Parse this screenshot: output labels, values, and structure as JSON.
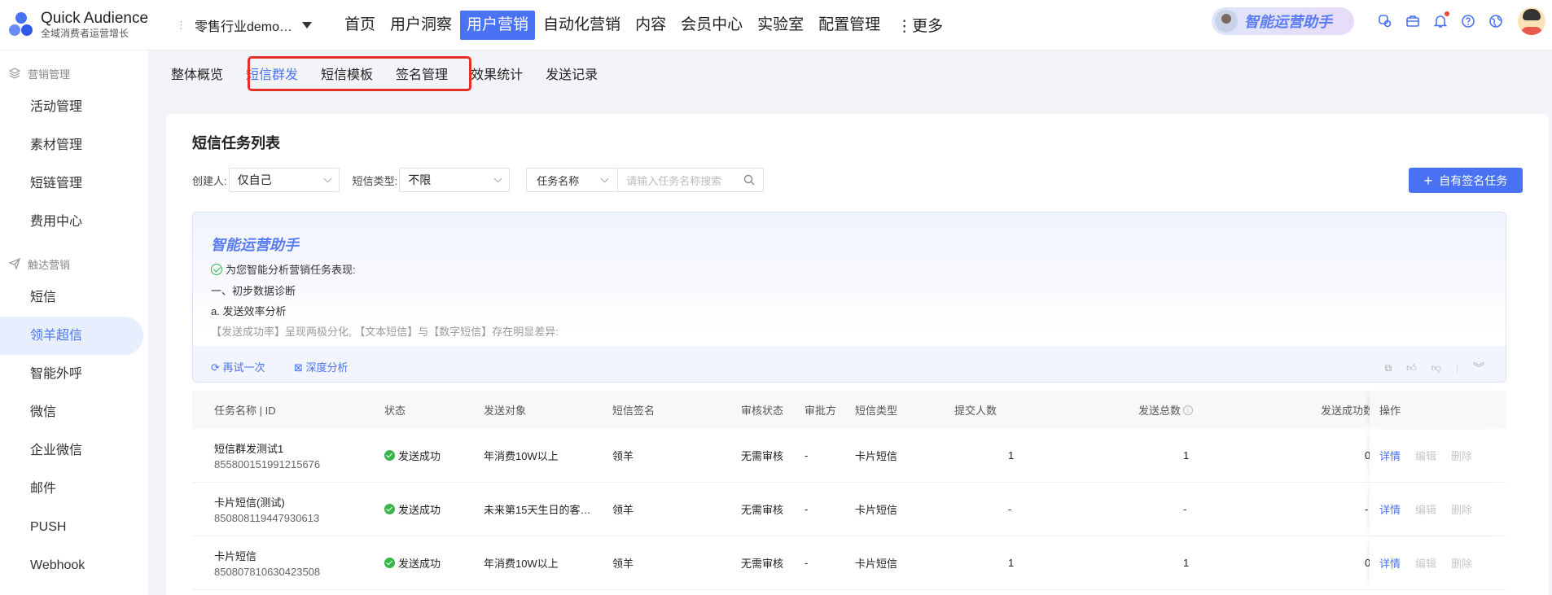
{
  "brand": {
    "name": "Quick Audience",
    "tagline": "全域消费者运营增长"
  },
  "tenant": {
    "name": "零售行业demo…"
  },
  "nav": {
    "items": [
      "首页",
      "用户洞察",
      "用户营销",
      "自动化营销",
      "内容",
      "会员中心",
      "实验室",
      "配置管理"
    ],
    "active": "用户营销",
    "more": "⋮更多"
  },
  "assistant_pill": {
    "label": "智能运营助手"
  },
  "top_icons": [
    "app-icon",
    "briefcase-icon",
    "bell-icon",
    "help-icon",
    "globe-icon"
  ],
  "sidebar": {
    "groups": [
      {
        "label": "营销管理",
        "icon": "layers-icon",
        "items": [
          "活动管理",
          "素材管理",
          "短链管理",
          "费用中心"
        ]
      },
      {
        "label": "触达营销",
        "icon": "send-icon",
        "items": [
          "短信",
          "领羊超信",
          "智能外呼",
          "微信",
          "企业微信",
          "邮件",
          "PUSH",
          "Webhook"
        ]
      }
    ],
    "active": "领羊超信"
  },
  "subtabs": {
    "items": [
      "整体概览",
      "短信群发",
      "短信模板",
      "签名管理",
      "效果统计",
      "发送记录"
    ],
    "active": "短信群发"
  },
  "page": {
    "title": "短信任务列表"
  },
  "filters": {
    "creator_label": "创建人:",
    "creator_value": "仅自己",
    "type_label": "短信类型:",
    "type_value": "不限",
    "search_field": "任务名称",
    "search_placeholder": "请输入任务名称搜索"
  },
  "primary_button": {
    "label": "自有签名任务"
  },
  "ai_panel": {
    "title": "智能运营助手",
    "line1": "为您智能分析营销任务表现:",
    "line2": "一、初步数据诊断",
    "line3": "a. 发送效率分析",
    "line4": "【发送成功率】呈现两极分化, 【文本短信】与【数字短信】存在明显差异:",
    "retry": "再试一次",
    "deep": "深度分析"
  },
  "table": {
    "headers": {
      "name": "任务名称 | ID",
      "status": "状态",
      "target": "发送对象",
      "signature": "短信签名",
      "review_status": "审核状态",
      "approver": "审批方",
      "type": "短信类型",
      "submit_count": "提交人数",
      "send_total": "发送总数",
      "send_success": "发送成功数",
      "ops": "操作"
    },
    "rows": [
      {
        "name": "短信群发测试1",
        "id": "855800151991215676",
        "status": "发送成功",
        "target": "年消费10W以上",
        "signature": "领羊",
        "review_status": "无需审核",
        "approver": "-",
        "type": "卡片短信",
        "submit_count": "1",
        "send_total": "1",
        "send_success": "0"
      },
      {
        "name": "卡片短信(测试)",
        "id": "850808119447930613",
        "status": "发送成功",
        "target": "未来第15天生日的客…",
        "signature": "领羊",
        "review_status": "无需审核",
        "approver": "-",
        "type": "卡片短信",
        "submit_count": "-",
        "send_total": "-",
        "send_success": "-"
      },
      {
        "name": "卡片短信",
        "id": "850807810630423508",
        "status": "发送成功",
        "target": "年消费10W以上",
        "signature": "领羊",
        "review_status": "无需审核",
        "approver": "-",
        "type": "卡片短信",
        "submit_count": "1",
        "send_total": "1",
        "send_success": "0"
      }
    ],
    "ops": {
      "detail": "详情",
      "edit": "编辑",
      "delete": "删除"
    }
  },
  "colors": {
    "accent": "#4a72f5",
    "success": "#39b54a",
    "highlight": "#e5302a"
  }
}
